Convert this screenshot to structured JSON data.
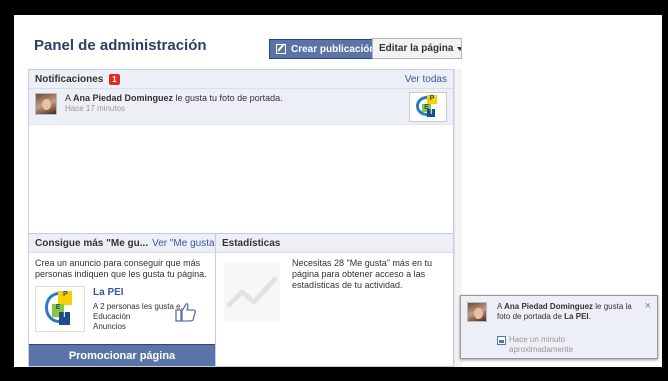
{
  "header": {
    "title": "Panel de administración",
    "create_post_label": "Crear publicación",
    "edit_page_label": "Editar la página"
  },
  "notifications": {
    "title": "Notificaciones",
    "count": "1",
    "see_all": "Ver todas",
    "items": [
      {
        "prefix": "A ",
        "name": "Ana Piedad Dominguez",
        "action": " le gusta tu foto de portada.",
        "time": "Hace 17 minutos"
      }
    ]
  },
  "promo": {
    "title": "Consigue más \"Me gu...",
    "link": "Ver \"Me gusta\"",
    "description": "Crea un anuncio para conseguir que más personas indiquen que les gusta tu página.",
    "ad": {
      "name": "La PEI",
      "line1": "A 2 personas les gusta e...",
      "line2": "Educación",
      "line3": "Anuncios"
    },
    "button": "Promocionar página"
  },
  "stats": {
    "title": "Estadísticas",
    "text": "Necesitas 28 \"Me gusta\" más en tu página para obtener acceso a las estadísticas de tu actividad."
  },
  "toast": {
    "prefix": "A ",
    "name": "Ana Piedad Dominguez",
    "middle": " le gusta la foto de portada de ",
    "page": "La PEI",
    "end": ".",
    "close": "×",
    "time": "Hace un minuto aproximadamente"
  },
  "logo_letters": {
    "p": "P",
    "e": "E",
    "i": "I"
  },
  "colors": {
    "brand_blue": "#3b5998",
    "button_blue": "#5b74a8",
    "badge_red": "#e02a2a",
    "panel_bg": "#eceff5"
  }
}
